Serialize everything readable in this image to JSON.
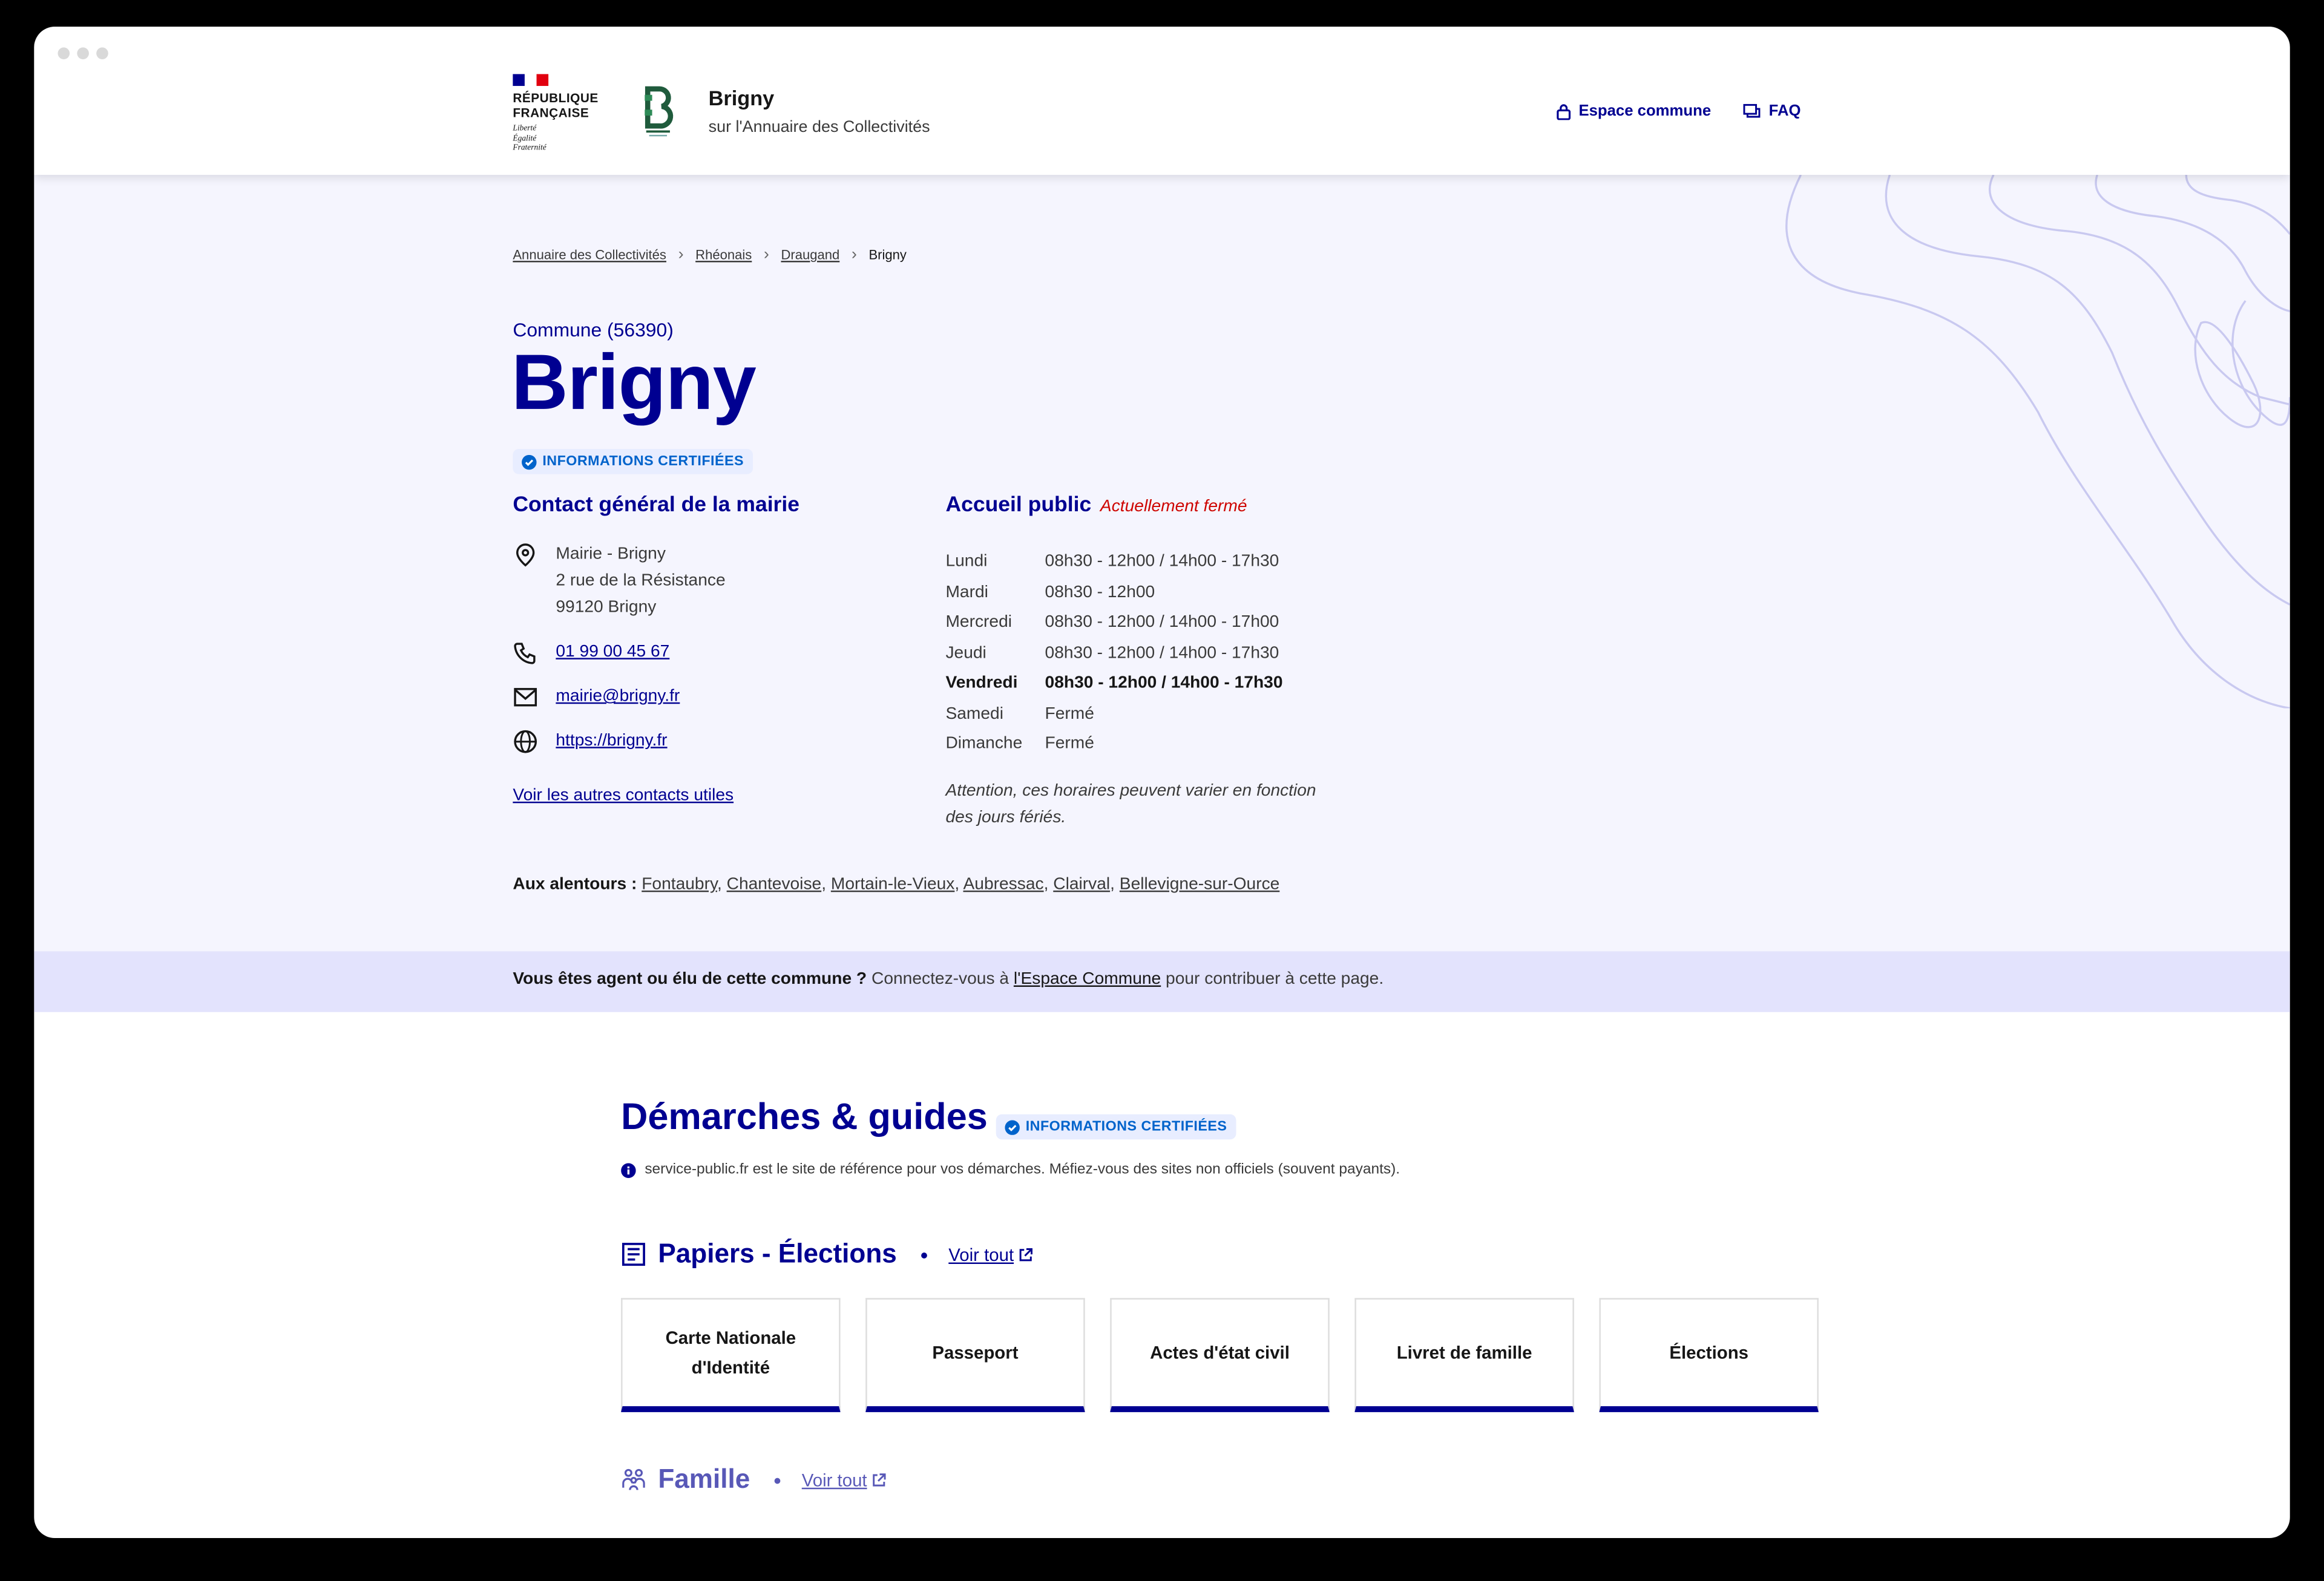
{
  "header": {
    "gov_name_line1": "RÉPUBLIQUE",
    "gov_name_line2": "FRANÇAISE",
    "devise": [
      "Liberté",
      "Égalité",
      "Fraternité"
    ],
    "site_title": "Brigny",
    "site_subtitle": "sur l'Annuaire des Collectivités",
    "tools": {
      "espace_label": "Espace commune",
      "faq_label": "FAQ"
    }
  },
  "breadcrumb": [
    "Annuaire des Collectivités",
    "Rhéonais",
    "Draugand",
    "Brigny"
  ],
  "commune": {
    "kicker": "Commune (56390)",
    "name": "Brigny",
    "certified_label": "INFORMATIONS CERTIFIÉES"
  },
  "contact": {
    "title": "Contact général de la mairie",
    "address": [
      "Mairie - Brigny",
      "2 rue de la Résistance",
      "99120 Brigny"
    ],
    "phone": "01 99 00 45 67",
    "email": "mairie@brigny.fr",
    "website": "https://brigny.fr",
    "other_contacts_link": "Voir les autres contacts utiles"
  },
  "accueil": {
    "title": "Accueil public",
    "status": "Actuellement fermé",
    "hours": [
      {
        "day": "Lundi",
        "time": "08h30 - 12h00 / 14h00 - 17h30"
      },
      {
        "day": "Mardi",
        "time": "08h30 - 12h00"
      },
      {
        "day": "Mercredi",
        "time": "08h30 - 12h00 / 14h00 - 17h00"
      },
      {
        "day": "Jeudi",
        "time": "08h30 - 12h00 / 14h00 - 17h30"
      },
      {
        "day": "Vendredi",
        "time": "08h30 - 12h00 / 14h00 - 17h30"
      },
      {
        "day": "Samedi",
        "time": "Fermé"
      },
      {
        "day": "Dimanche",
        "time": "Fermé"
      }
    ],
    "note_line1": "Attention, ces horaires peuvent varier en fonction",
    "note_line2": "des jours fériés."
  },
  "around": {
    "label": "Aux alentours :",
    "towns": [
      "Fontaubry",
      "Chantevoise",
      "Mortain-le-Vieux",
      "Aubressac",
      "Clairval",
      "Bellevigne-sur-Ource"
    ]
  },
  "agent_bar": {
    "question": "Vous êtes agent ou élu de cette commune ?",
    "text_before": "Connectez-vous à",
    "link": "l'Espace Commune",
    "text_after": "pour contribuer à cette page."
  },
  "demarches": {
    "title": "Démarches & guides",
    "certified_label": "INFORMATIONS CERTIFIÉES",
    "info": "service-public.fr est le site de référence pour vos démarches. Méfiez-vous des sites non officiels (souvent payants).",
    "sections": [
      {
        "title": "Papiers - Élections",
        "see_all": "Voir tout",
        "cards": [
          "Carte Nationale d'Identité",
          "Passeport",
          "Actes d'état civil",
          "Livret de famille",
          "Élections"
        ]
      },
      {
        "title": "Famille",
        "see_all": "Voir tout"
      }
    ]
  },
  "colors": {
    "primary": "#000091",
    "hero_bg": "#f5f5fe",
    "agent_bar_bg": "#e3e3fd",
    "closed_red": "#ce0500",
    "badge_blue": "#0063cb"
  }
}
